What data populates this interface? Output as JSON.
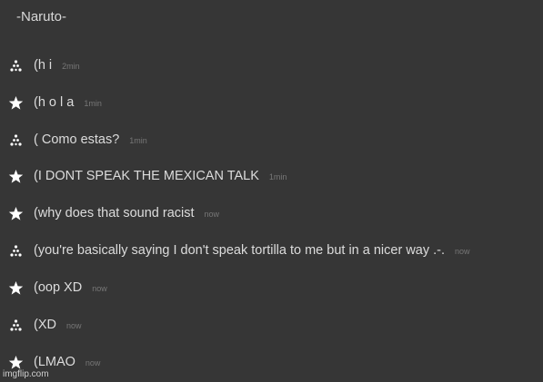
{
  "chat": {
    "title": "-Naruto-",
    "messages": [
      {
        "avatar": "triangle-dots-icon",
        "text": "(h i",
        "time": "2min"
      },
      {
        "avatar": "star-icon",
        "text": "(h o l a",
        "time": "1min"
      },
      {
        "avatar": "triangle-dots-icon",
        "text": "( Como estas?",
        "time": "1min"
      },
      {
        "avatar": "star-icon",
        "text": "(I DONT SPEAK THE MEXICAN TALK",
        "time": "1min"
      },
      {
        "avatar": "star-icon",
        "text": "(why does that sound racist",
        "time": "now"
      },
      {
        "avatar": "triangle-dots-icon",
        "text": "(you're basically saying I don't speak tortilla to me but in a nicer way .-.",
        "time": "now"
      },
      {
        "avatar": "star-icon",
        "text": "(oop XD",
        "time": "now"
      },
      {
        "avatar": "triangle-dots-icon",
        "text": "(XD",
        "time": "now"
      },
      {
        "avatar": "star-icon",
        "text": "(LMAO",
        "time": "now"
      }
    ]
  },
  "watermark": "imgflip.com",
  "colors": {
    "background": "#363636",
    "text": "#dcdcdc",
    "timestamp": "#777777"
  }
}
